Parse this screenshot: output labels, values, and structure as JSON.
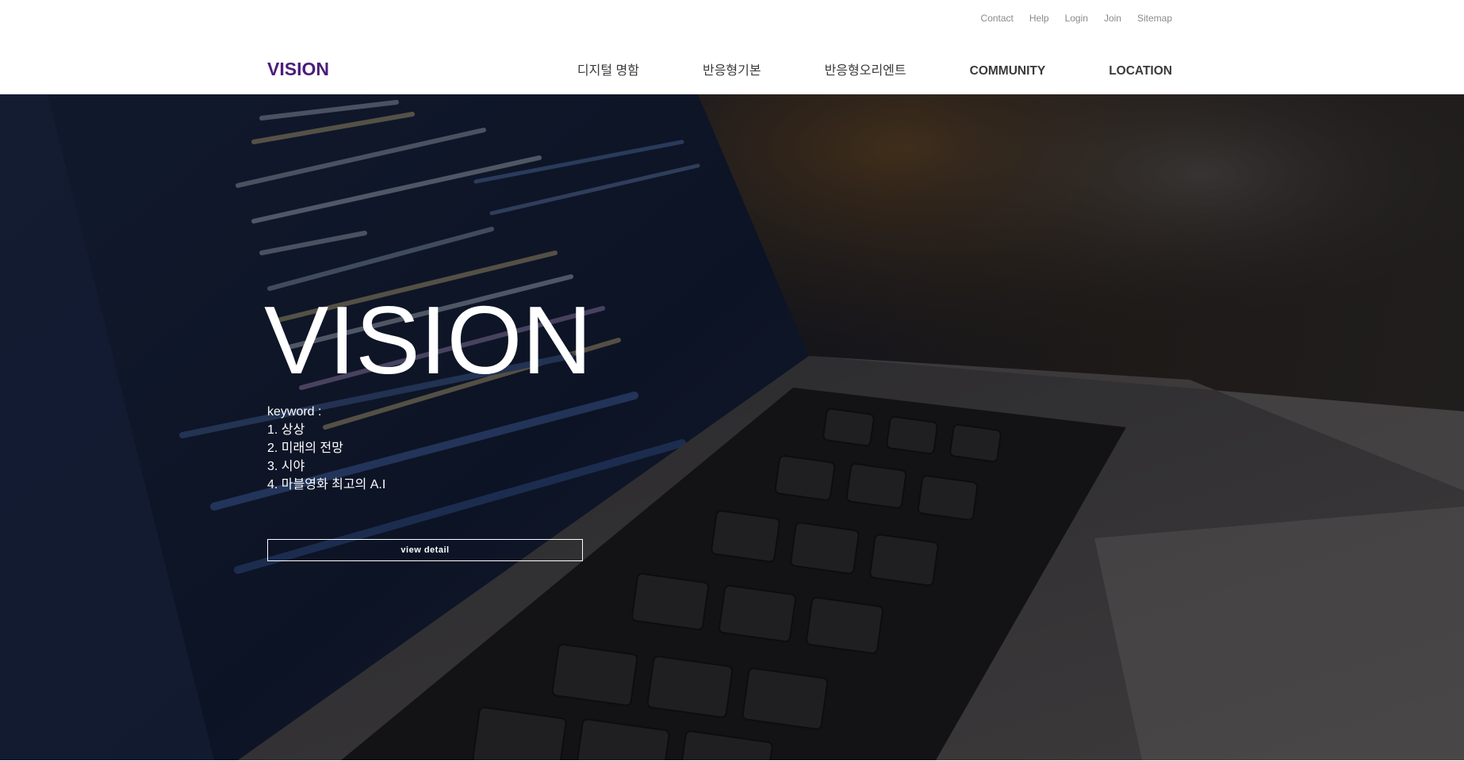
{
  "header": {
    "logo": "VISION",
    "utility_links": [
      "Contact",
      "Help",
      "Login",
      "Join",
      "Sitemap"
    ],
    "nav_items": [
      "디지털 명함",
      "반응형기본",
      "반응형오리엔트",
      "COMMUNITY",
      "LOCATION"
    ]
  },
  "hero": {
    "title": "VISION",
    "keyword_label": "keyword :",
    "keywords": [
      "1. 상상",
      "2. 미래의 전망",
      "3. 시야",
      "4. 마블영화 최고의 A.I"
    ],
    "button_label": "view detail",
    "background_icon": "laptop-keyboard-photo"
  },
  "colors": {
    "logo": "#4b1d7a",
    "nav_text": "#3a3a3a",
    "utility_text": "#8a8a8a",
    "hero_text": "#ffffff"
  }
}
